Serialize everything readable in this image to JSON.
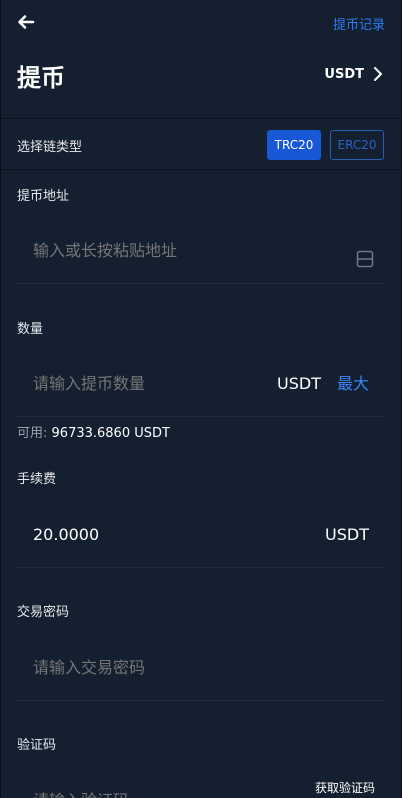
{
  "header": {
    "back_icon": "arrow-left-icon",
    "history_link": "提币记录"
  },
  "title": {
    "text": "提币",
    "coin": "USDT",
    "coin_icon": "chevron-right-icon"
  },
  "chain": {
    "label": "选择链类型",
    "options": [
      "TRC20",
      "ERC20"
    ],
    "selected": "TRC20"
  },
  "address": {
    "label": "提币地址",
    "placeholder": "输入或长按粘贴地址",
    "scan_icon": "scan-icon"
  },
  "amount": {
    "label": "数量",
    "placeholder": "请输入提币数量",
    "unit": "USDT",
    "max_label": "最大",
    "available_label": "可用:",
    "available_value": "96733.6860 USDT"
  },
  "fee": {
    "label": "手续费",
    "value": "20.0000",
    "unit": "USDT"
  },
  "password": {
    "label": "交易密码",
    "placeholder": "请输入交易密码"
  },
  "verify": {
    "label": "验证码",
    "placeholder": "请输入验证码",
    "get_code": "获取验证码"
  },
  "colors": {
    "background": "#141f2f",
    "accent": "#2e7bf6",
    "active_button": "#1658d6"
  }
}
